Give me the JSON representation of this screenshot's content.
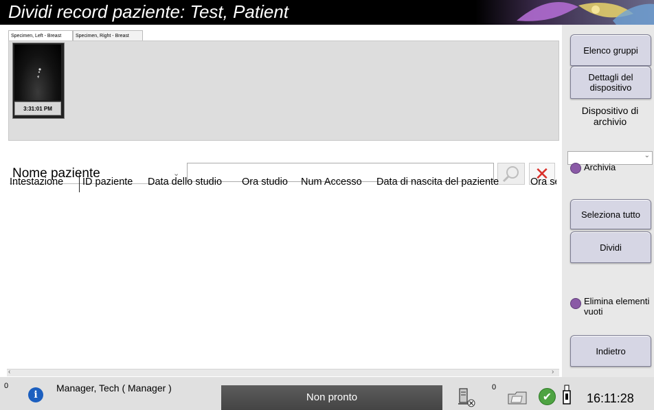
{
  "window": {
    "title": "Dividi record paziente: Test, Patient"
  },
  "tabs": [
    {
      "label": "Specimen, Left - Breast"
    },
    {
      "label": "Specimen, Right - Breast"
    }
  ],
  "thumbnail": {
    "time": "3:31:01 PM"
  },
  "search": {
    "field_selected": "Nome paziente",
    "value": ""
  },
  "table": {
    "columns": [
      "Intestazione",
      "ID paziente",
      "Data dello studio",
      "Ora studio",
      "Num Accesso",
      "Data di nascita del paziente",
      "Ora se"
    ],
    "rows": []
  },
  "right_panel": {
    "group_list": "Elenco gruppi",
    "device_details": "Dettagli del dispositivo",
    "archive_device_label": "Dispositivo di archivio",
    "archive_device_value": "",
    "archive_option": "Archivia",
    "select_all": "Seleziona tutto",
    "split": "Dividi",
    "delete_empty": "Elimina elementi vuoti",
    "back": "Indietro"
  },
  "status_bar": {
    "left_count": "0",
    "user": "Manager, Tech ( Manager )",
    "status": "Non pronto",
    "queue_count": "0",
    "time": "16:11:28"
  },
  "colors": {
    "title_bg": "#000000",
    "button_bg": "#d6d6e4",
    "radio": "#8a5aa6",
    "status_box": "#4f4f4f",
    "clear_icon": "#d9302a",
    "ok_icon": "#4ea342"
  },
  "icons": [
    "search-icon",
    "close-icon",
    "info-icon",
    "network-disconnected-icon",
    "file-transfer-icon",
    "check-icon",
    "usb-icon",
    "chevron-down-icon"
  ]
}
